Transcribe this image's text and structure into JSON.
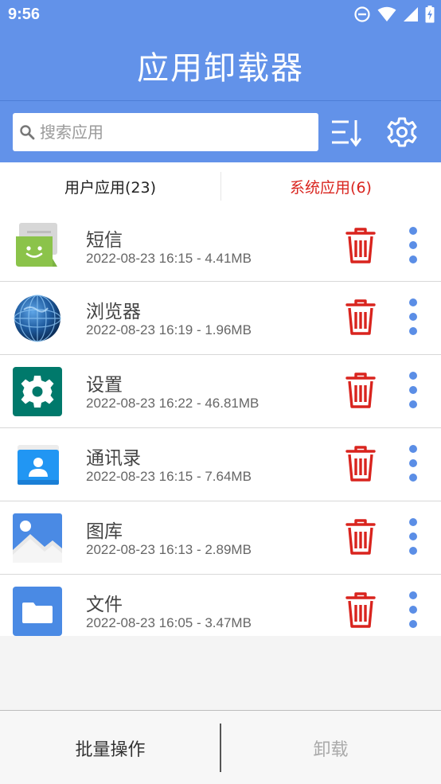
{
  "status_bar": {
    "time": "9:56"
  },
  "app_bar": {
    "title": "应用卸载器"
  },
  "search": {
    "placeholder": "搜索应用",
    "value": ""
  },
  "tabs": [
    {
      "label": "用户应用(23)",
      "active": false
    },
    {
      "label": "系统应用(6)",
      "active": true
    }
  ],
  "apps": [
    {
      "name": "短信",
      "meta": "2022-08-23 16:15 - 4.41MB",
      "icon": "messages-icon"
    },
    {
      "name": "浏览器",
      "meta": "2022-08-23 16:19 - 1.96MB",
      "icon": "browser-icon"
    },
    {
      "name": "设置",
      "meta": "2022-08-23 16:22 - 46.81MB",
      "icon": "settings-app-icon"
    },
    {
      "name": "通讯录",
      "meta": "2022-08-23 16:15 - 7.64MB",
      "icon": "contacts-icon"
    },
    {
      "name": "图库",
      "meta": "2022-08-23 16:13 - 2.89MB",
      "icon": "gallery-icon"
    },
    {
      "name": "文件",
      "meta": "2022-08-23 16:05 - 3.47MB",
      "icon": "files-icon"
    }
  ],
  "bottom_bar": {
    "batch_label": "批量操作",
    "uninstall_label": "卸载"
  },
  "colors": {
    "primary": "#6292e9",
    "danger": "#d9241e",
    "accent_dots": "#5b8ee6"
  }
}
